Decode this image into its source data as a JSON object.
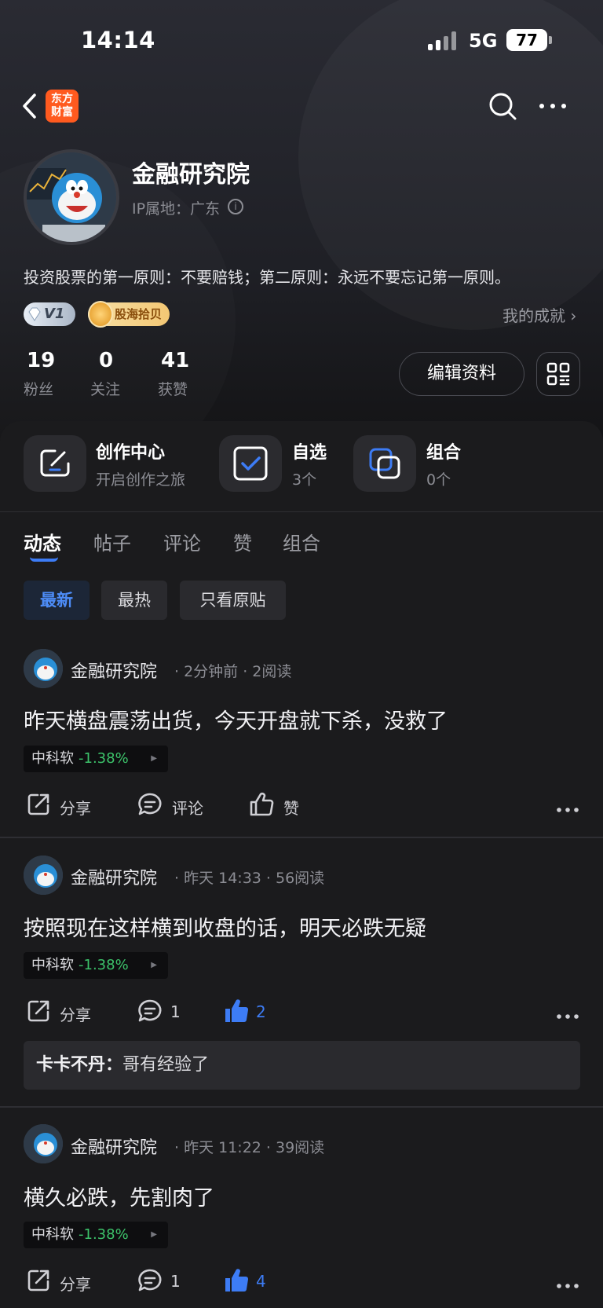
{
  "status_bar": {
    "time": "14:14",
    "network": "5G",
    "battery": "77"
  },
  "nav": {
    "logo_line1": "东方",
    "logo_line2": "财富"
  },
  "profile": {
    "name": "金融研究院",
    "ip_location": "IP属地：广东",
    "bio": "投资股票的第一原则：不要赔钱；第二原则：永远不要忘记第一原则。",
    "level_badge": "V1",
    "medal_badge": "股海拾贝",
    "achievements_label": "我的成就 ›",
    "edit_button": "编辑资料"
  },
  "stats": [
    {
      "value": "19",
      "label": "粉丝"
    },
    {
      "value": "0",
      "label": "关注"
    },
    {
      "value": "41",
      "label": "获赞"
    }
  ],
  "quick_entries": [
    {
      "title": "创作中心",
      "subtitle": "开启创作之旅",
      "icon": "edit-icon"
    },
    {
      "title": "自选",
      "subtitle": "3个",
      "icon": "checkbox-icon"
    },
    {
      "title": "组合",
      "subtitle": "0个",
      "icon": "overlap-squares-icon"
    }
  ],
  "tabs": [
    "动态",
    "帖子",
    "评论",
    "赞",
    "组合"
  ],
  "filters": [
    "最新",
    "最热",
    "只看原贴"
  ],
  "posts": [
    {
      "author": "金融研究院",
      "meta": "· 2分钟前 · 2阅读",
      "text": "昨天横盘震荡出货，今天开盘就下杀，没救了",
      "stock": "中科软",
      "stock_change": "-1.38%",
      "share_label": "分享",
      "comment_label": "评论",
      "like_label": "赞",
      "liked": false
    },
    {
      "author": "金融研究院",
      "meta": "· 昨天 14:33 · 56阅读",
      "text": "按照现在这样横到收盘的话，明天必跌无疑",
      "stock": "中科软",
      "stock_change": "-1.38%",
      "share_label": "分享",
      "comment_label": "1",
      "like_label": "2",
      "liked": true,
      "comment_preview": {
        "user": "卡卡不丹：",
        "text": "哥有经验了"
      }
    },
    {
      "author": "金融研究院",
      "meta": "· 昨天 11:22 · 39阅读",
      "text": "横久必跌，先割肉了",
      "stock": "中科软",
      "stock_change": "-1.38%",
      "share_label": "分享",
      "comment_label": "1",
      "like_label": "4",
      "liked": true
    }
  ],
  "colors": {
    "accent_blue": "#3d7cf5",
    "stock_green": "#3cc26a",
    "logo_orange": "#ff5a1f",
    "background": "#141416"
  }
}
